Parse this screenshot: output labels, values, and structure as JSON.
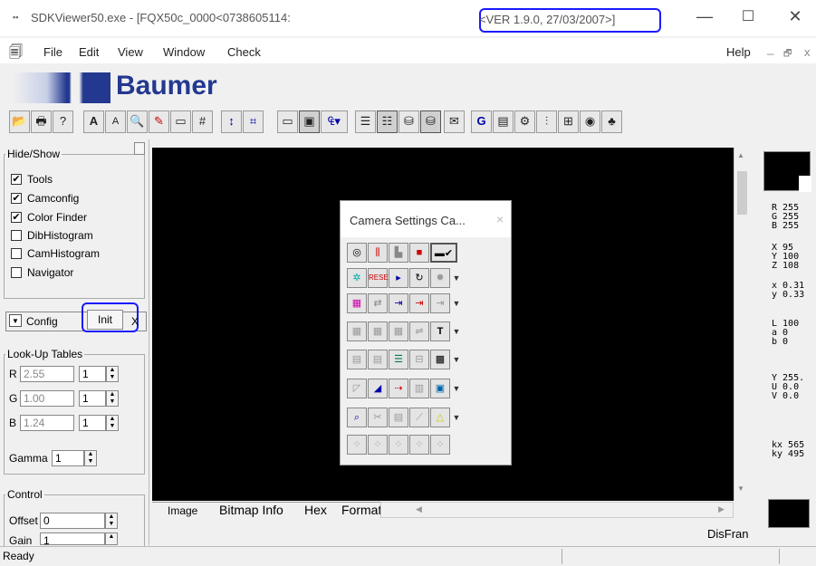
{
  "window": {
    "title": "SDKViewer50.exe - [FQX50c_0000<0738605114:",
    "version": "<VER 1.9.0, 27/03/2007>]",
    "minimize": "—",
    "maximize": "☐",
    "close": "✕"
  },
  "menu": {
    "items": [
      "File",
      "Edit",
      "View",
      "Window",
      "Check"
    ],
    "help": "Help",
    "mdi_min": "_",
    "mdi_restore": "🗗",
    "mdi_close": "x"
  },
  "logo": {
    "text": "Baumer"
  },
  "toolbar": {
    "buttons": [
      "open-icon",
      "print-icon",
      "help-icon",
      "font-up-icon",
      "font-down-icon",
      "zoom-icon",
      "pen-icon",
      "rect-icon",
      "grid-icon",
      "range-icon",
      "cross-icon",
      "camera-icon",
      "camera-settings-icon",
      "colors-icon",
      "list-icon",
      "list2-icon",
      "save-mpg-icon",
      "save-file-icon",
      "notes-icon",
      "g-icon",
      "doc-icon",
      "config-icon",
      "tune-icon",
      "network-icon",
      "firewire-icon",
      "plugin-icon"
    ]
  },
  "left_panel": {
    "hide_show": {
      "title": "Hide/Show",
      "items": [
        {
          "label": "Tools",
          "checked": true
        },
        {
          "label": "Camconfig",
          "checked": true
        },
        {
          "label": "Color Finder",
          "checked": true
        },
        {
          "label": "DibHistogram",
          "checked": false
        },
        {
          "label": "CamHistogram",
          "checked": false
        },
        {
          "label": "Navigator",
          "checked": false
        }
      ]
    },
    "config": {
      "dropdown_label": "Config",
      "init_label": "Init",
      "close_label": "X"
    },
    "lut": {
      "title": "Look-Up Tables",
      "rows": [
        {
          "channel": "R",
          "value": "2.55",
          "step": "1"
        },
        {
          "channel": "G",
          "value": "1.00",
          "step": "1"
        },
        {
          "channel": "B",
          "value": "1.24",
          "step": "1"
        }
      ],
      "gamma_label": "Gamma",
      "gamma_value": "1"
    },
    "control": {
      "title": "Control",
      "offset_label": "Offset",
      "offset_value": "0",
      "gain_label": "Gain",
      "gain_value": "1"
    }
  },
  "tabs": [
    "Image",
    "Bitmap Info",
    "Hex",
    "Format"
  ],
  "right_panel": {
    "rgb": [
      "R 255",
      "G 255",
      "B 255"
    ],
    "xyz": [
      "X 95",
      "Y 100",
      "Z 108"
    ],
    "xy": [
      "x 0.31",
      "y 0.33"
    ],
    "lab": [
      "L 100",
      "a 0",
      "b 0"
    ],
    "yuv": [
      "Y 255.",
      "U 0.0",
      "V 0.0"
    ],
    "k": [
      "kx 565",
      "ky 495"
    ],
    "disfran": "DisFran"
  },
  "camera_settings": {
    "title": "Camera Settings Ca...",
    "close": "×"
  },
  "status": {
    "text": "Ready"
  },
  "colors": {
    "accent": "#1a1aff",
    "brand": "#23388f",
    "image_bg": "#000000"
  }
}
